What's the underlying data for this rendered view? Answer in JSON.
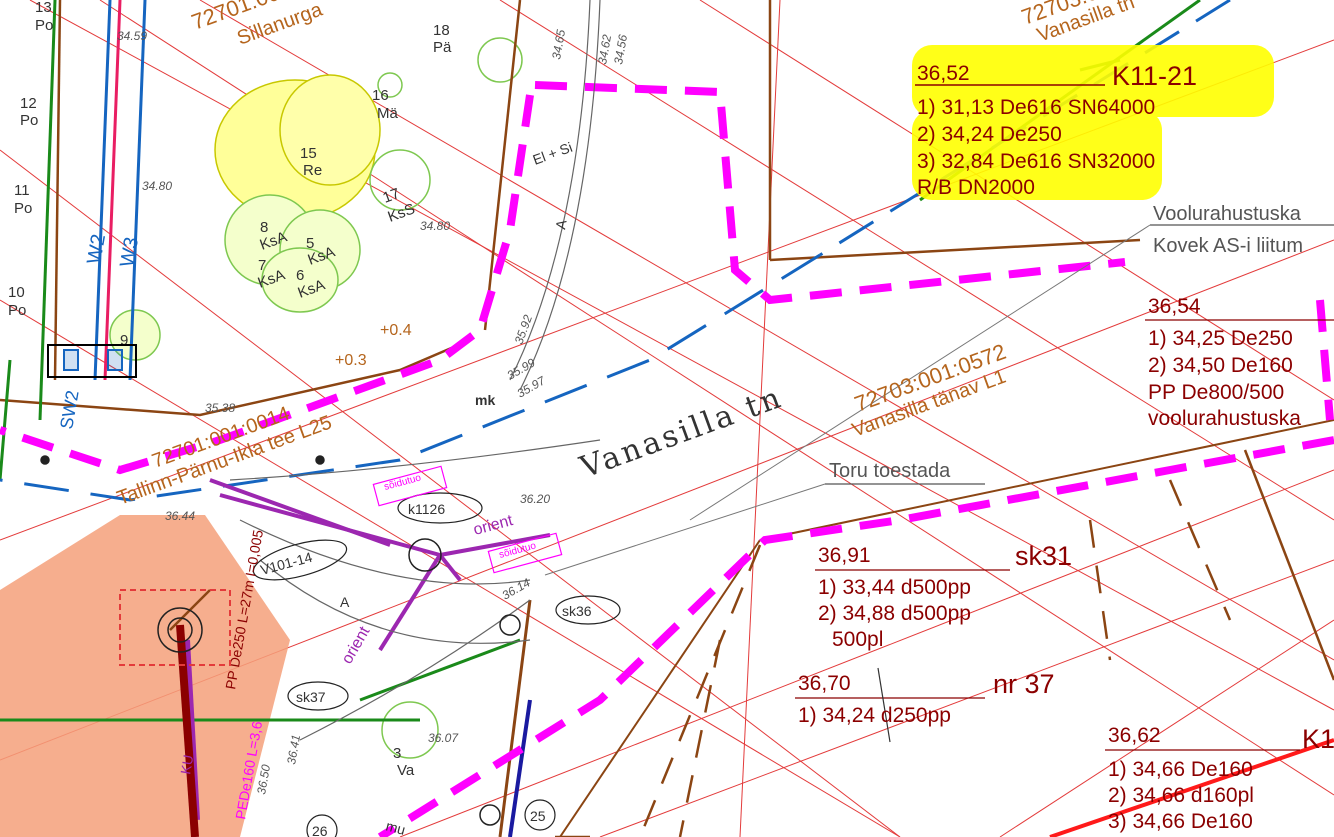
{
  "colors": {
    "background": "#ffffff",
    "property_lines": "#e33b3b",
    "boundary_magenta": "#ff00ff",
    "blue_pipe": "#1565c0",
    "green_pipe": "#1a8a1a",
    "brown_lines": "#8b4513",
    "label_red": "#8b0000",
    "highlight": "#ffff00",
    "orange_area": "#f4a07a",
    "purple": "#9c27b0",
    "tree_fill": "#ffff99"
  },
  "labels": {
    "k11_21": {
      "elev": "36,52",
      "id": "K11-21",
      "lines": [
        "1) 31,13 De616 SN64000",
        "2) 34,24 De250",
        "3) 32,84 De616 SN32000",
        "R/B  DN2000"
      ]
    },
    "voolu_top": "Voolurahustuska",
    "kovek": "Kovek AS-i liitum",
    "c36_54": {
      "elev": "36,54",
      "lines": [
        "1) 34,25 De250",
        "2) 34,50 De160",
        "PP  De800/500",
        "voolurahustuska"
      ]
    },
    "toru": "Toru toestada",
    "sk31": {
      "elev": "36,91",
      "id": "sk31",
      "lines": [
        "1) 33,44 d500pp",
        "2) 34,88 d500pp",
        "500pl"
      ]
    },
    "nr37": {
      "elev": "36,70",
      "id": "nr 37",
      "lines": [
        "1) 34,24 d250pp"
      ]
    },
    "c36_62": {
      "elev": "36,62",
      "id": "K1",
      "lines": [
        "1) 34,66 De160",
        "2) 34,66 d160pl",
        "3) 34,66 De160"
      ]
    }
  },
  "map_text": {
    "street": "Vanasilla tn",
    "parcel_0572": "72703:001:0572",
    "parcel_0572_sub": "Vanasilla tänav L1",
    "parcel_top": "72701:00",
    "parcel_top_sub": "Sillanurga",
    "parcel_top_right": "72703:0",
    "parcel_top_right_sub": "Vanasilla tn",
    "parcel_left": "72701:001:0014",
    "parcel_left_sub": "Tallinn-Pärnu-Ikla tee L25",
    "k1126": "k1126",
    "sk36": "sk36",
    "sk37": "sk37",
    "v101": "V101-14",
    "orient": "orient",
    "soidutuo": "sõidutuo",
    "mk": "mk",
    "el_si": "El + Si",
    "plus04": "+0.4",
    "plus03": "+0.3",
    "w2": "W2",
    "w3": "W3",
    "sw2": "SW2",
    "pipe_spec": "PP De250 L=27m I=0,005",
    "pede": "PEDe160 L=3,6",
    "n25": "25",
    "n26": "26",
    "mu": "mu",
    "a": "A",
    "ku": "KU",
    "elevations": [
      "34.59",
      "34.80",
      "34.80",
      "34.65",
      "34.62",
      "34.56",
      "35.92",
      "35.99",
      "35.97",
      "35.38",
      "36.20",
      "36.44",
      "36.14",
      "36.07",
      "36.41",
      "36.50"
    ],
    "trees": [
      {
        "n": "18",
        "s": "Pä"
      },
      {
        "n": "16",
        "s": "Mä"
      },
      {
        "n": "15",
        "s": "Re"
      },
      {
        "n": "17",
        "s": "KsS"
      },
      {
        "n": "8",
        "s": "KsA"
      },
      {
        "n": "5",
        "s": "KsA"
      },
      {
        "n": "7",
        "s": "KsA"
      },
      {
        "n": "6",
        "s": "KsA"
      },
      {
        "n": "12",
        "s": "Po"
      },
      {
        "n": "11",
        "s": "Po"
      },
      {
        "n": "10",
        "s": "Po"
      },
      {
        "n": "13",
        "s": "Po"
      },
      {
        "n": "3",
        "s": "Va"
      },
      {
        "n": "9",
        "s": ""
      }
    ]
  }
}
